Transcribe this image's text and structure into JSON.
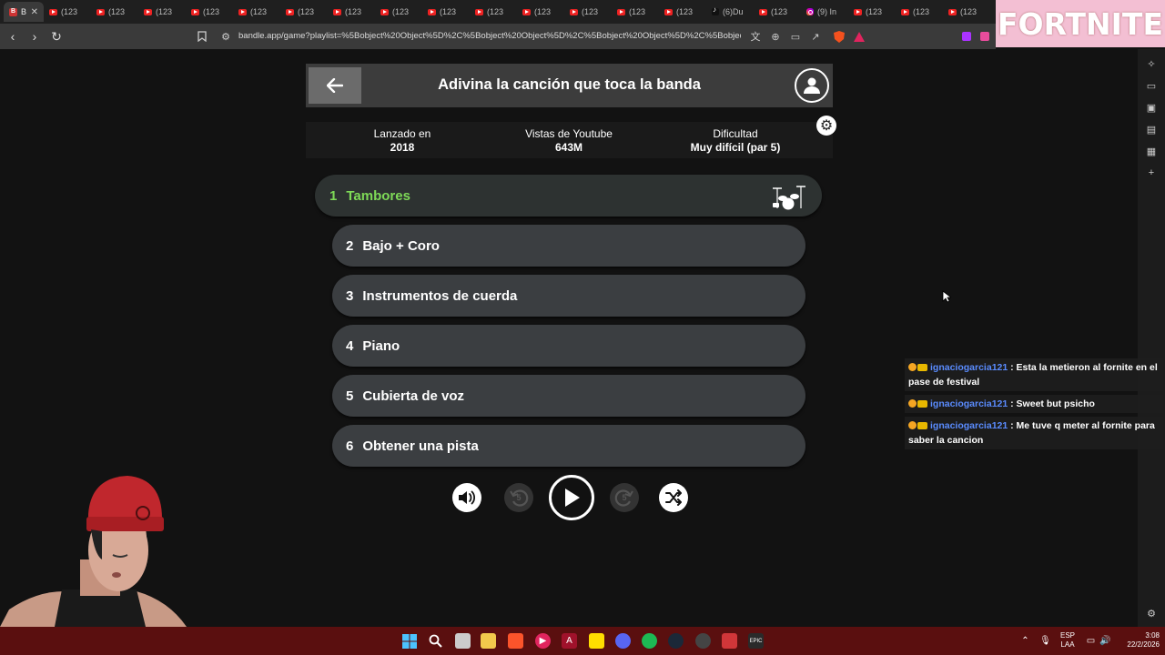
{
  "browser": {
    "tabs": [
      {
        "label": "B",
        "icon": "bandle-icon",
        "active": true
      },
      {
        "label": "(123",
        "icon": "youtube-icon"
      },
      {
        "label": "(123",
        "icon": "youtube-icon"
      },
      {
        "label": "(123",
        "icon": "youtube-icon"
      },
      {
        "label": "(123",
        "icon": "youtube-icon"
      },
      {
        "label": "(123",
        "icon": "youtube-icon"
      },
      {
        "label": "(123",
        "icon": "youtube-icon"
      },
      {
        "label": "(123",
        "icon": "youtube-icon"
      },
      {
        "label": "(123",
        "icon": "youtube-icon"
      },
      {
        "label": "(123",
        "icon": "youtube-icon"
      },
      {
        "label": "(123",
        "icon": "youtube-icon"
      },
      {
        "label": "(123",
        "icon": "youtube-icon"
      },
      {
        "label": "(123",
        "icon": "youtube-icon"
      },
      {
        "label": "(123",
        "icon": "youtube-icon"
      },
      {
        "label": "(123",
        "icon": "youtube-icon"
      },
      {
        "label": "(6)Du",
        "icon": "tiktok-icon"
      },
      {
        "label": "(123",
        "icon": "youtube-icon"
      },
      {
        "label": "(9) In",
        "icon": "instagram-icon"
      },
      {
        "label": "(123",
        "icon": "youtube-icon"
      },
      {
        "label": "(123",
        "icon": "youtube-icon"
      },
      {
        "label": "(123",
        "icon": "youtube-icon"
      }
    ],
    "url": "bandle.app/game?playlist=%5Bobject%20Object%5D%2C%5Bobject%20Object%5D%2C%5Bobject%20Object%5D%2C%5Bobject%20Object%5D%2C%5Bobject%20Object%5D%2C%5Bobject%20Object%5D"
  },
  "overlay": {
    "banner": "FORTNITE"
  },
  "game": {
    "title": "Adivina la canción que toca la banda",
    "stats": [
      {
        "label": "Lanzado en",
        "value": "2018"
      },
      {
        "label": "Vistas de Youtube",
        "value": "643M"
      },
      {
        "label": "Dificultad",
        "value": "Muy difícil (par 5)"
      }
    ],
    "hints": [
      {
        "num": "1",
        "label": "Tambores",
        "active": true
      },
      {
        "num": "2",
        "label": "Bajo + Coro"
      },
      {
        "num": "3",
        "label": "Instrumentos de cuerda"
      },
      {
        "num": "4",
        "label": "Piano"
      },
      {
        "num": "5",
        "label": "Cubierta de voz"
      },
      {
        "num": "6",
        "label": "Obtener una pista"
      }
    ],
    "controls": {
      "rewind_seconds": "5",
      "forward_seconds": "5"
    }
  },
  "chat": [
    {
      "user": "ignaciogarcia121",
      "text": ": Esta la metieron al fornite en el pase de festival"
    },
    {
      "user": "ignaciogarcia121",
      "text": ": Sweet but psicho"
    },
    {
      "user": "ignaciogarcia121",
      "text": ": Me tuve q meter al fornite para saber la cancion"
    }
  ],
  "taskbar": {
    "lang": "ESP",
    "lang2": "LAA",
    "time": "3:08",
    "date": "22/2/2026"
  },
  "colors": {
    "active_hint": "#7ed957",
    "hint_bg": "#3b3e41",
    "taskbar": "#5a0f0f",
    "banner": "#f3bfd3"
  }
}
